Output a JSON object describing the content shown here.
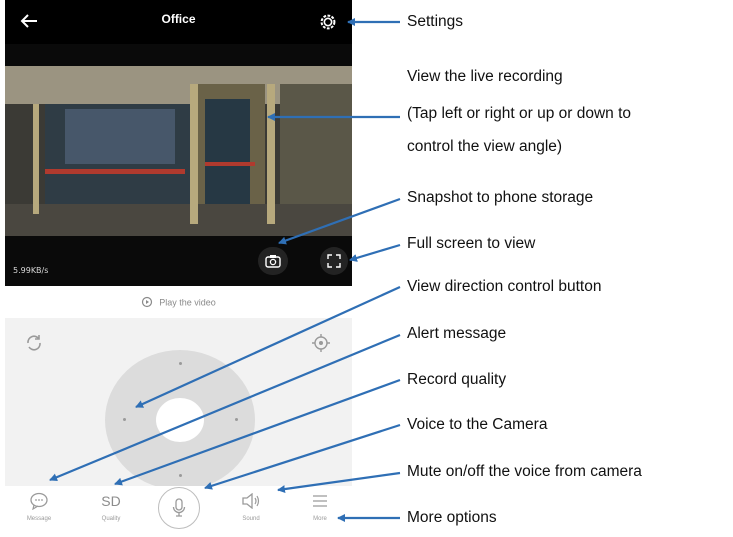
{
  "screen": {
    "title": "Office",
    "speed": "5.99KB/s",
    "play_video": "Play the video"
  },
  "toolbar": {
    "message_label": "Message",
    "quality_value": "SD",
    "quality_label": "Quality",
    "sound_label": "Sound",
    "more_label": "More"
  },
  "annotations": {
    "settings": "Settings",
    "live_line1": "View the live recording",
    "live_line2": "(Tap left or right or up or down to",
    "live_line3": "control the view angle)",
    "snapshot": "Snapshot to phone storage",
    "fullscreen": "Full screen to view",
    "direction": "View direction control button",
    "alert": "Alert message",
    "quality": "Record quality",
    "voice": "Voice to the Camera",
    "mute": "Mute on/off the voice from camera",
    "more": "More options"
  },
  "colors": {
    "arrow": "#2f6fb5",
    "topbar": "#000000",
    "panel": "#f2f2f2"
  }
}
